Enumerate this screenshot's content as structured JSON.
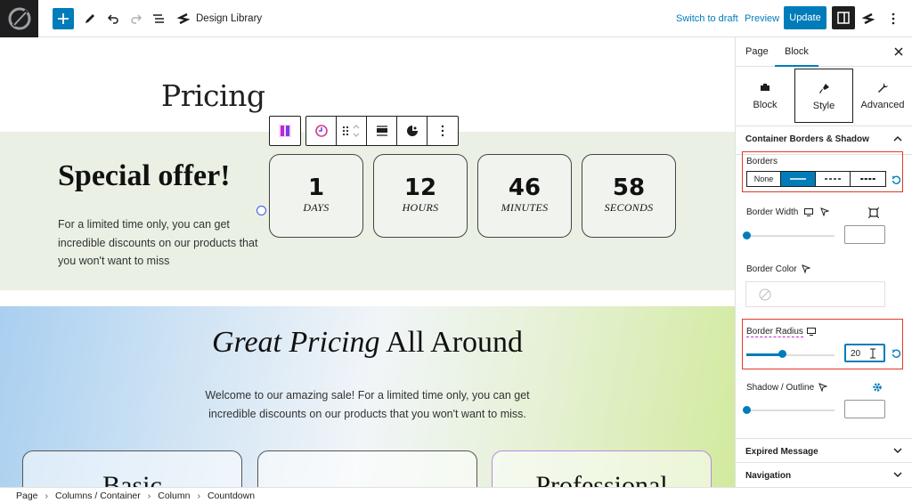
{
  "topbar": {
    "document_title": "Design Library",
    "switch_to_draft": "Switch to draft",
    "preview": "Preview",
    "update": "Update"
  },
  "canvas": {
    "page_heading": "Pricing",
    "offer": {
      "title": "Special offer!",
      "text": "For a limited time only, you can get incredible discounts on our products that you won't want to miss"
    },
    "countdown": [
      {
        "value": "1",
        "label": "DAYS"
      },
      {
        "value": "12",
        "label": "HOURS"
      },
      {
        "value": "46",
        "label": "MINUTES"
      },
      {
        "value": "58",
        "label": "SECONDS"
      }
    ],
    "great": {
      "title_italic": "Great Pricing",
      "title_rest": " All Around",
      "text": "Welcome to our amazing sale! For a limited time only, you can get incredible discounts on our products that you won't want to miss."
    },
    "price_cards": [
      "Basic",
      "",
      "Professional"
    ]
  },
  "breadcrumb": [
    "Page",
    "Columns / Container",
    "Column",
    "Countdown"
  ],
  "sidebar": {
    "tabs": [
      "Page",
      "Block"
    ],
    "active_tab": "Block",
    "modes": [
      {
        "label": "Block",
        "icon": "block-icon"
      },
      {
        "label": "Style",
        "icon": "brush-icon"
      },
      {
        "label": "Advanced",
        "icon": "wrench-icon"
      }
    ],
    "active_mode": "Style",
    "panel_title": "Container Borders & Shadow",
    "borders": {
      "label": "Borders",
      "options": [
        "None",
        "solid",
        "dashed",
        "dotted"
      ],
      "selected": "solid"
    },
    "border_width": {
      "label": "Border Width",
      "value": "",
      "slider_fraction": 0.0
    },
    "border_color": {
      "label": "Border Color"
    },
    "border_radius": {
      "label": "Border Radius",
      "value": "20",
      "slider_fraction": 0.4
    },
    "shadow": {
      "label": "Shadow / Outline",
      "value": "",
      "slider_fraction": 0.0
    },
    "accordions": [
      "Expired Message",
      "Navigation"
    ]
  },
  "colors": {
    "accent": "#007cba",
    "highlight": "#e0382a",
    "offer_bg": "#eaf0e4",
    "dark": "#1e1e1e"
  }
}
